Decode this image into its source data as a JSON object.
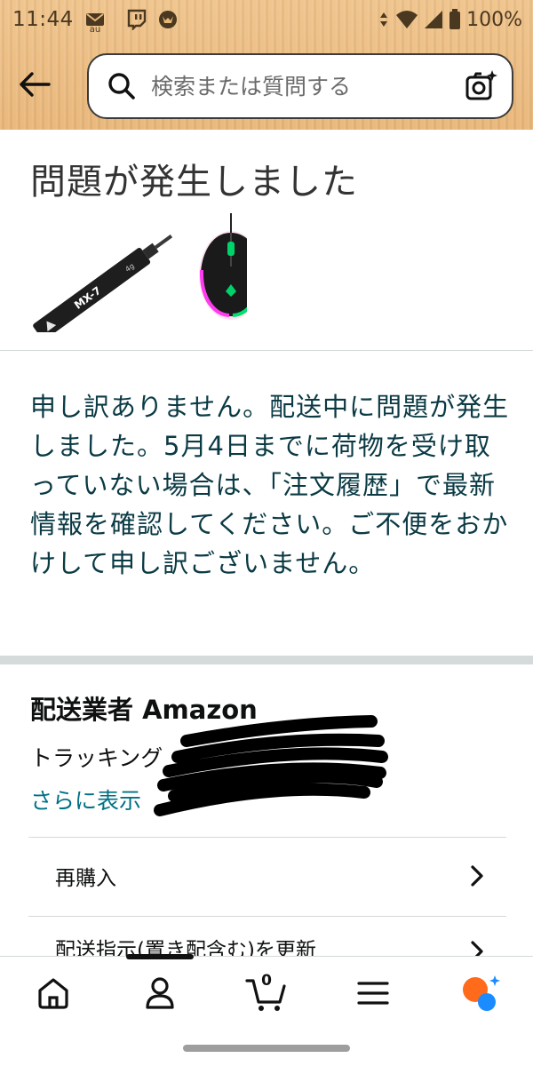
{
  "status_bar": {
    "time": "11:44",
    "carrier_badge": "au",
    "battery": "100%",
    "icons": [
      "mail-icon",
      "twitch-icon",
      "pokemon-icon",
      "data-arrows-icon",
      "wifi-icon",
      "signal-icon",
      "battery-icon"
    ]
  },
  "header": {
    "search_placeholder": "検索または質問する",
    "back_icon": "arrow-left-icon",
    "camera_icon": "camera-sparkle-icon"
  },
  "page": {
    "title": "問題が発生しました",
    "products": [
      {
        "name": "MX-7 thermal paste syringe",
        "icon": "syringe-product-image",
        "label": "MX-7",
        "weight": "4g"
      },
      {
        "name": "Razer gaming mouse",
        "icon": "mouse-product-image"
      }
    ],
    "message": "申し訳ありません。配送中に問題が発生しました。5月4日までに荷物を受け取っていない場合は、「注文履歴」で最新情報を確認してください。ご不便をおかけして申し訳ございません。",
    "carrier_line": "配送業者 Amazon",
    "tracking_label": "トラッキング",
    "show_more": "さらに表示",
    "actions": [
      {
        "label": "再購入"
      },
      {
        "label": "配送指示(置き配含む)を更新"
      }
    ]
  },
  "bottom_nav": {
    "items": [
      "home-icon",
      "account-icon",
      "cart-icon",
      "menu-icon",
      "assistant-icon"
    ],
    "cart_count": "0"
  },
  "colors": {
    "header_wood": "#e9b77a",
    "link": "#007185",
    "message_text": "#0a3a44",
    "assistant_orange": "#ff6b1a",
    "assistant_blue": "#1a8cff",
    "section_band": "#d5dbdb"
  }
}
